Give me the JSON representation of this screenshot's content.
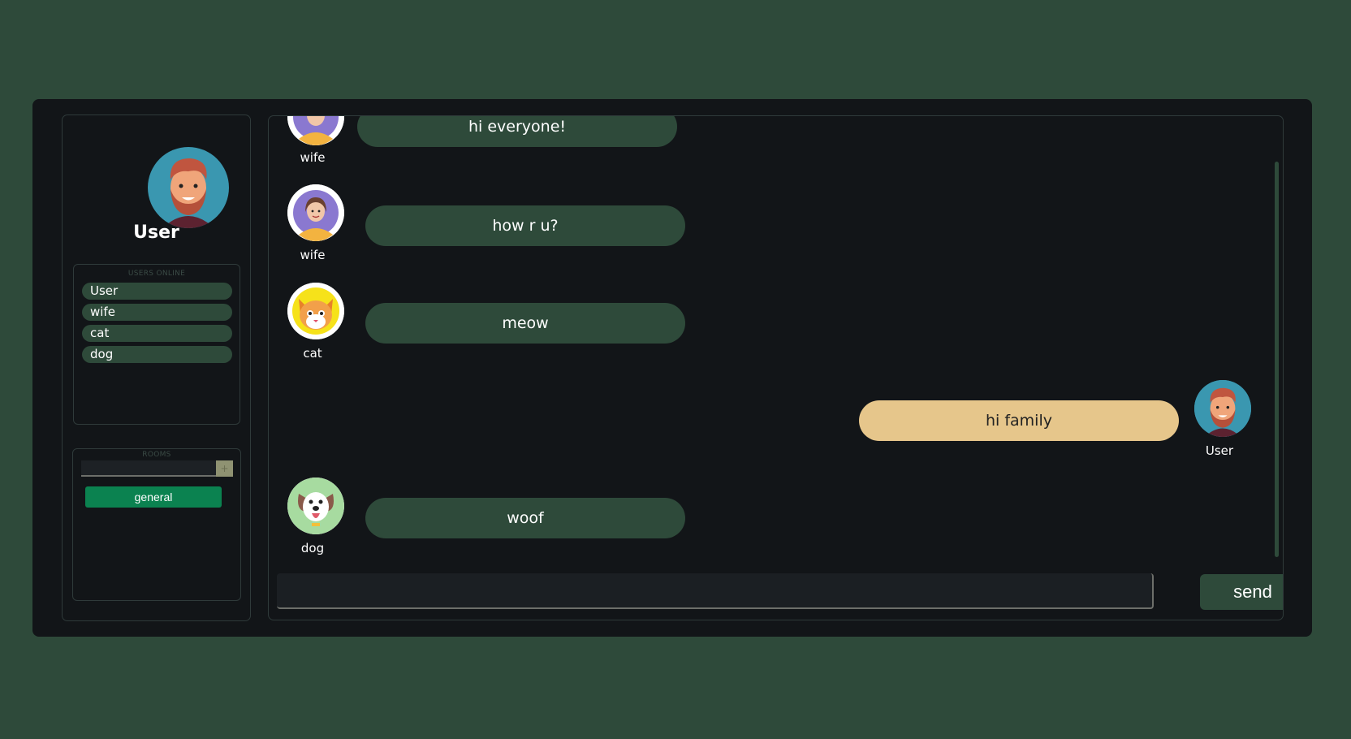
{
  "profile": {
    "name": "User",
    "avatar_icon": "bearded-man-avatar"
  },
  "users_online": {
    "title": "USERS ONLINE",
    "users": [
      "User",
      "wife",
      "cat",
      "dog"
    ]
  },
  "rooms": {
    "title": "ROOMS",
    "add_label": "+",
    "input_value": "",
    "items": [
      "general"
    ]
  },
  "messages": [
    {
      "sender": "wife",
      "text": "hi everyone!",
      "avatar_icon": "woman-avatar",
      "own": false
    },
    {
      "sender": "wife",
      "text": "how r u?",
      "avatar_icon": "woman-avatar",
      "own": false
    },
    {
      "sender": "cat",
      "text": "meow",
      "avatar_icon": "cat-avatar",
      "own": false
    },
    {
      "sender": "User",
      "text": "hi family",
      "avatar_icon": "bearded-man-avatar",
      "own": true
    },
    {
      "sender": "dog",
      "text": "woof",
      "avatar_icon": "dog-avatar",
      "own": false
    }
  ],
  "composer": {
    "value": "",
    "send_label": "send"
  },
  "colors": {
    "background": "#2e4a3a",
    "panel": "#121518",
    "bubble_other": "#2e4a3a",
    "bubble_self": "#e6c68b",
    "room_active": "#0b8250"
  }
}
